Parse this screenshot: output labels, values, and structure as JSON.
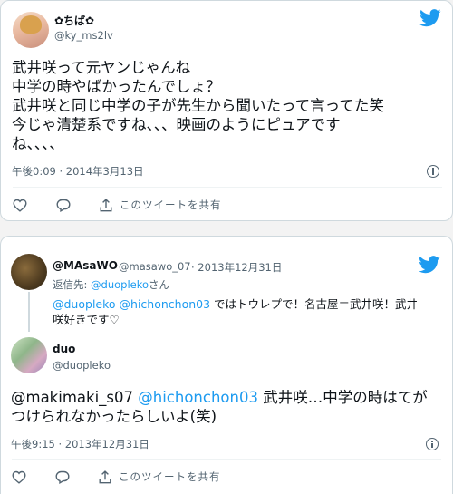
{
  "tweet1": {
    "name": "✿ちば✿",
    "handle": "@ky_ms2lv",
    "lines": [
      "武井咲って元ヤンじゃんね",
      "中学の時やばかったんでしょ？",
      "武井咲と同じ中学の子が先生から聞いたって言ってた笑",
      "今じゃ清楚系ですね、、、映画のようにピュアです",
      "ね、、、、"
    ],
    "timestamp": "午後0:09 · 2014年3月13日",
    "share_label": "このツイートを共有"
  },
  "tweet2": {
    "reply_parent": {
      "name": "@MAsaWO",
      "handle": "@masawo_07",
      "date": "· 2013年12月31日",
      "reply_to_prefix": "返信先: ",
      "reply_to_user": "@duopleko",
      "reply_to_suffix": "さん",
      "text_mention1": "@duopleko",
      "text_mention2": "@hichonchon03",
      "text_line1_rest": " ではトウレプで！名古屋＝武井咲！武井",
      "text_line2": "咲好きです♡"
    },
    "name": "duo",
    "handle": "@duopleko",
    "mention1": "@makimaki_s07",
    "mention2": "@hichonchon03",
    "line1_rest": " 武井咲…中学の時はてが",
    "line2": "つけられなかったらしいよ(笑)",
    "timestamp": "午後9:15 · 2013年12月31日",
    "share_label": "このツイートを共有"
  },
  "colors": {
    "link": "#1d9bf0",
    "twitter_blue": "#1d9bf0",
    "muted": "#536471"
  },
  "icons": [
    "twitter-bird-icon",
    "info-icon",
    "heart-icon",
    "reply-icon",
    "share-icon"
  ]
}
